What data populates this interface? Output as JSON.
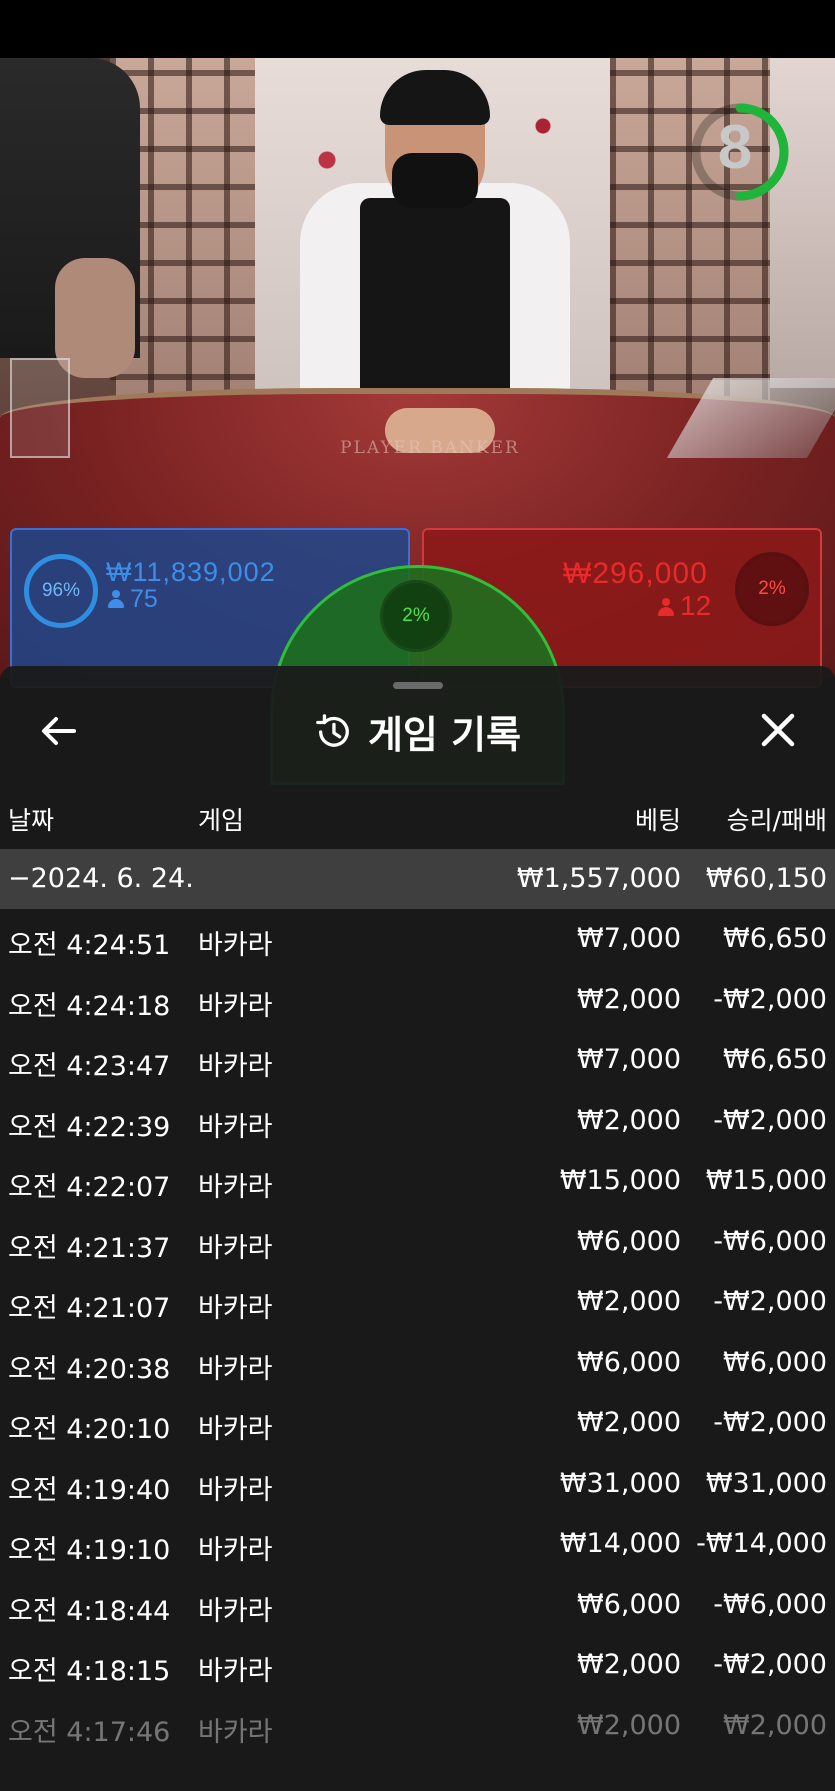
{
  "timer": {
    "value": "8",
    "color": "#1fb53a"
  },
  "table_label": "PLAYER     BANKER",
  "bets": {
    "player": {
      "percent": "96%",
      "amount": "₩11,839,002",
      "count": "75",
      "color": "#2f8ee0"
    },
    "tie": {
      "percent": "2%",
      "color": "#2fbf3a"
    },
    "banker": {
      "percent": "2%",
      "amount": "₩296,000",
      "count": "12",
      "color": "#e82a2a"
    }
  },
  "panel": {
    "title": "게임 기록",
    "icons": {
      "back": "arrow-left-icon",
      "history": "history-icon",
      "close": "close-icon"
    },
    "columns": {
      "date": "날짜",
      "game": "게임",
      "bet": "베팅",
      "result": "승리/패배"
    },
    "group": {
      "date": "−2024. 6. 24.",
      "bet": "₩1,557,000",
      "result": "₩60,150"
    },
    "rows": [
      {
        "time": "오전 4:24:51",
        "game": "바카라",
        "bet": "₩7,000",
        "result": "₩6,650"
      },
      {
        "time": "오전 4:24:18",
        "game": "바카라",
        "bet": "₩2,000",
        "result": "-₩2,000"
      },
      {
        "time": "오전 4:23:47",
        "game": "바카라",
        "bet": "₩7,000",
        "result": "₩6,650"
      },
      {
        "time": "오전 4:22:39",
        "game": "바카라",
        "bet": "₩2,000",
        "result": "-₩2,000"
      },
      {
        "time": "오전 4:22:07",
        "game": "바카라",
        "bet": "₩15,000",
        "result": "₩15,000"
      },
      {
        "time": "오전 4:21:37",
        "game": "바카라",
        "bet": "₩6,000",
        "result": "-₩6,000"
      },
      {
        "time": "오전 4:21:07",
        "game": "바카라",
        "bet": "₩2,000",
        "result": "-₩2,000"
      },
      {
        "time": "오전 4:20:38",
        "game": "바카라",
        "bet": "₩6,000",
        "result": "₩6,000"
      },
      {
        "time": "오전 4:20:10",
        "game": "바카라",
        "bet": "₩2,000",
        "result": "-₩2,000"
      },
      {
        "time": "오전 4:19:40",
        "game": "바카라",
        "bet": "₩31,000",
        "result": "₩31,000"
      },
      {
        "time": "오전 4:19:10",
        "game": "바카라",
        "bet": "₩14,000",
        "result": "-₩14,000"
      },
      {
        "time": "오전 4:18:44",
        "game": "바카라",
        "bet": "₩6,000",
        "result": "-₩6,000"
      },
      {
        "time": "오전 4:18:15",
        "game": "바카라",
        "bet": "₩2,000",
        "result": "-₩2,000"
      },
      {
        "time": "오전 4:17:46",
        "game": "바카라",
        "bet": "₩2,000",
        "result": "₩2,000"
      }
    ]
  }
}
